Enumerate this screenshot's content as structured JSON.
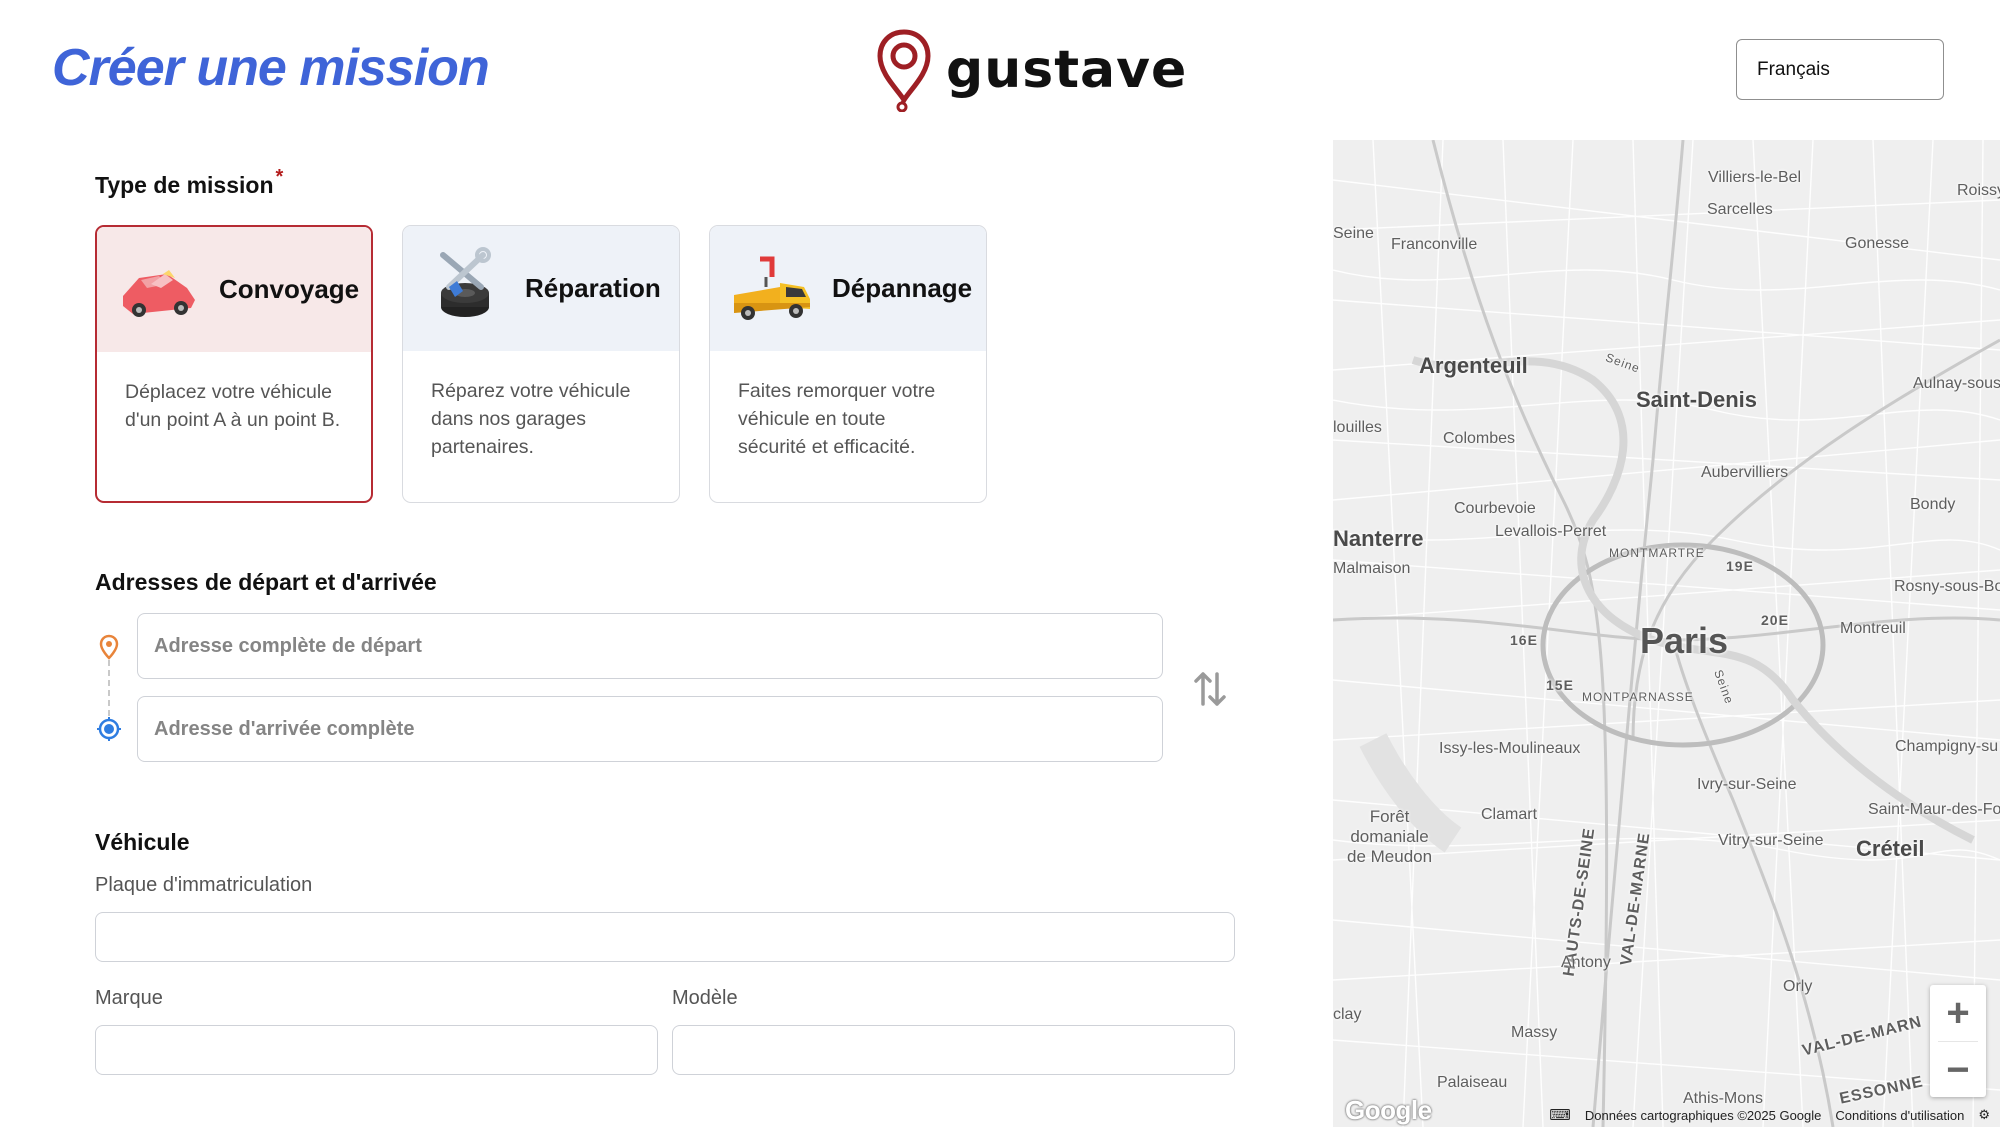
{
  "header": {
    "title": "Créer une mission",
    "logo_text": "gustave",
    "language": "Français"
  },
  "mission_type": {
    "title": "Type de mission",
    "required_mark": "*",
    "options": [
      {
        "label": "Convoyage",
        "description": "Déplacez votre véhicule d'un point A à un point B.",
        "selected": true,
        "icon": "car-icon"
      },
      {
        "label": "Réparation",
        "description": "Réparez votre véhicule dans nos garages partenaires.",
        "selected": false,
        "icon": "tire-wrench-icon"
      },
      {
        "label": "Dépannage",
        "description": "Faites remorquer votre véhicule en toute sécurité et efficacité.",
        "selected": false,
        "icon": "tow-truck-icon"
      }
    ]
  },
  "addresses": {
    "title": "Adresses de départ et d'arrivée",
    "departure_placeholder": "Adresse complète de départ",
    "arrival_placeholder": "Adresse d'arrivée complète",
    "departure_value": "",
    "arrival_value": ""
  },
  "vehicle": {
    "title": "Véhicule",
    "plate_label": "Plaque d'immatriculation",
    "plate_value": "",
    "brand_label": "Marque",
    "brand_value": "",
    "model_label": "Modèle",
    "model_value": ""
  },
  "map": {
    "labels": {
      "villiers": "Villiers-le-Bel",
      "roissy": "Roissy",
      "sarcelles": "Sarcelles",
      "seine_w": "Seine",
      "franconville": "Franconville",
      "gonesse": "Gonesse",
      "argenteuil": "Argenteuil",
      "seine_river": "Seine",
      "saint_denis": "Saint-Denis",
      "aulnay": "Aulnay-sous",
      "houilles": "louilles",
      "colombes": "Colombes",
      "aubervilliers": "Aubervilliers",
      "bondy": "Bondy",
      "courbevoie": "Courbevoie",
      "levallois": "Levallois-Perret",
      "nanterre": "Nanterre",
      "montmartre": "MONTMARTRE",
      "arr19": "19E",
      "rueil": "Malmaison",
      "rosny": "Rosny-sous-Bo",
      "arr20": "20E",
      "montreuil": "Montreuil",
      "arr16": "16E",
      "paris": "Paris",
      "arr15": "15E",
      "montparnasse": "MONTPARNASSE",
      "seine_paris": "Seine",
      "issy": "Issy-les-Moulineaux",
      "champigny": "Champigny-su",
      "ivry": "Ivry-sur-Seine",
      "foret": "Forêt\ndomaniale\nde Meudon",
      "clamart": "Clamart",
      "hauts_de_seine": "HAUTS-DE-SEINE",
      "val_de_marne": "VAL-DE-MARNE",
      "saint_maur": "Saint-Maur-des-Fo",
      "vitry": "Vitry-sur-Seine",
      "creteil": "Créteil",
      "antony": "Antony",
      "orly": "Orly",
      "clay": "clay",
      "massy": "Massy",
      "val_de_marne_2": "VAL-DE-MARN",
      "palaiseau": "Palaiseau",
      "athis": "Athis-Mons",
      "essonne": "ESSONNE"
    },
    "zoom_in": "+",
    "zoom_out": "−",
    "google": "Google",
    "attribution": "Données cartographiques ©2025 Google",
    "terms": "Conditions d'utilisation"
  }
}
